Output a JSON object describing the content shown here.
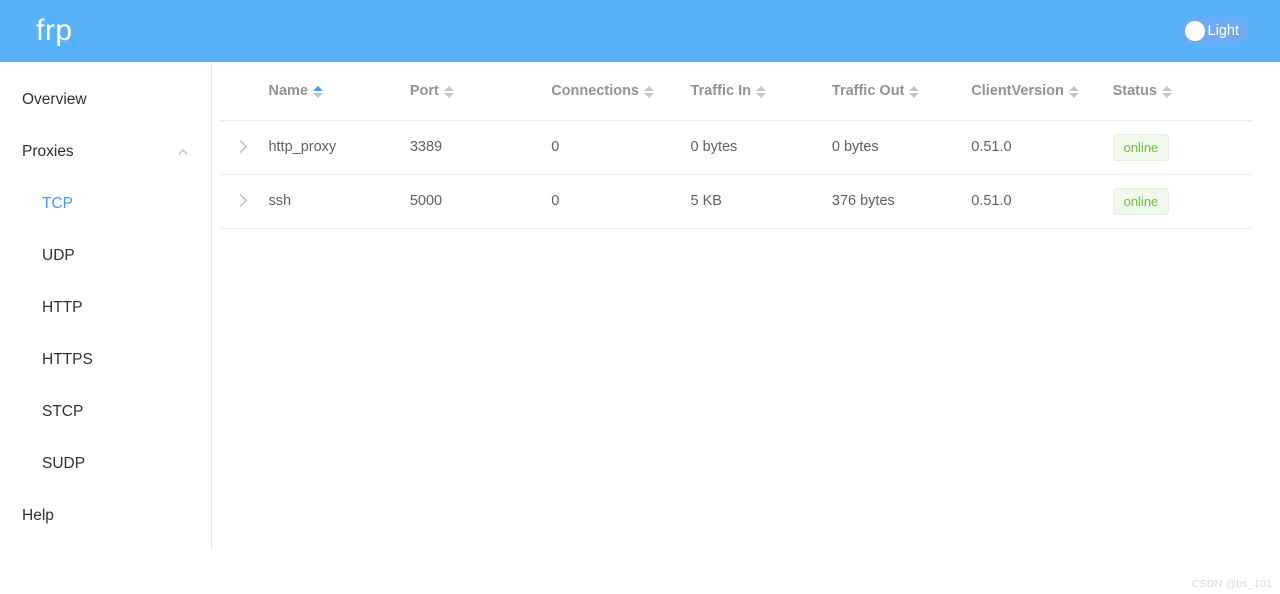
{
  "header": {
    "brand": "frp",
    "theme_toggle": {
      "label": "Light",
      "knob_icon": "toggle-knob-circle",
      "track_color": "#6ea9f2",
      "bar_color": "#58b2fa"
    }
  },
  "sidebar": {
    "items": [
      {
        "label": "Overview",
        "level": "top",
        "active": false
      },
      {
        "label": "Proxies",
        "level": "top",
        "active": false,
        "collapse_icon": "chevron-up-icon",
        "expanded": true
      },
      {
        "label": "TCP",
        "level": "sub",
        "active": true
      },
      {
        "label": "UDP",
        "level": "sub",
        "active": false
      },
      {
        "label": "HTTP",
        "level": "sub",
        "active": false
      },
      {
        "label": "HTTPS",
        "level": "sub",
        "active": false
      },
      {
        "label": "STCP",
        "level": "sub",
        "active": false
      },
      {
        "label": "SUDP",
        "level": "sub",
        "active": false
      },
      {
        "label": "Help",
        "level": "top",
        "active": false
      }
    ],
    "accent_color": "#409eff"
  },
  "table": {
    "columns": [
      {
        "label": "Name",
        "sortable": true,
        "sort": "asc"
      },
      {
        "label": "Port",
        "sortable": true,
        "sort": "none"
      },
      {
        "label": "Connections",
        "sortable": true,
        "sort": "none"
      },
      {
        "label": "Traffic In",
        "sortable": true,
        "sort": "none"
      },
      {
        "label": "Traffic Out",
        "sortable": true,
        "sort": "none"
      },
      {
        "label": "ClientVersion",
        "sortable": true,
        "sort": "none"
      },
      {
        "label": "Status",
        "sortable": true,
        "sort": "none"
      }
    ],
    "rows": [
      {
        "expand_icon": "chevron-right-icon",
        "name": "http_proxy",
        "port": "3389",
        "connections": "0",
        "traffic_in": "0 bytes",
        "traffic_out": "0 bytes",
        "client_version": "0.51.0",
        "status": "online"
      },
      {
        "expand_icon": "chevron-right-icon",
        "name": "ssh",
        "port": "5000",
        "connections": "0",
        "traffic_in": "5 KB",
        "traffic_out": "376 bytes",
        "client_version": "0.51.0",
        "status": "online"
      }
    ],
    "status_colors": {
      "online_text": "#67c23a",
      "online_bg": "#f0f9eb",
      "online_border": "#e1f3d8"
    }
  },
  "watermark": {
    "text": "CSDN @bs_101"
  }
}
